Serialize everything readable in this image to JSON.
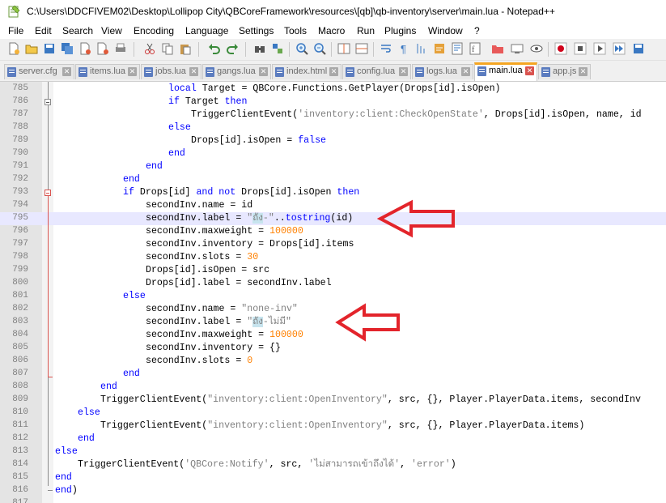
{
  "window": {
    "title": "C:\\Users\\DDCFIVEM02\\Desktop\\Lollipop City\\QBCoreFramework\\resources\\[qb]\\qb-inventory\\server\\main.lua - Notepad++",
    "app_icon": "notepad-plus-plus-icon"
  },
  "menu": [
    "File",
    "Edit",
    "Search",
    "View",
    "Encoding",
    "Language",
    "Settings",
    "Tools",
    "Macro",
    "Run",
    "Plugins",
    "Window",
    "?"
  ],
  "toolbar": [
    "new-file-icon",
    "open-file-icon",
    "save-icon",
    "save-all-icon",
    "close-icon",
    "close-all-icon",
    "print-icon",
    "cut-icon",
    "copy-icon",
    "paste-icon",
    "undo-icon",
    "redo-icon",
    "find-icon",
    "replace-icon",
    "zoom-in-icon",
    "zoom-out-icon",
    "sync-vertical-icon",
    "sync-horizontal-icon",
    "word-wrap-icon",
    "show-all-chars-icon",
    "indent-guide-icon",
    "udl-icon",
    "doc-map-icon",
    "function-list-icon",
    "folder-workspace-icon",
    "monitor-icon",
    "record-macro-icon",
    "stop-macro-icon",
    "play-macro-icon",
    "run-macro-multiple-icon",
    "save-macro-icon"
  ],
  "tabs": [
    {
      "label": "server.cfg",
      "active": false
    },
    {
      "label": "items.lua",
      "active": false
    },
    {
      "label": "jobs.lua",
      "active": false
    },
    {
      "label": "gangs.lua",
      "active": false
    },
    {
      "label": "index.html",
      "active": false
    },
    {
      "label": "config.lua",
      "active": false
    },
    {
      "label": "logs.lua",
      "active": false
    },
    {
      "label": "main.lua",
      "active": true
    },
    {
      "label": "app.js",
      "active": false
    }
  ],
  "colors": {
    "keyword": "#0000ff",
    "string": "#808080",
    "number": "#ff8000",
    "current_line": "#e8e8ff",
    "fold_marker": "#d9534f",
    "annotation_arrow": "#e3242b",
    "active_tab_accent": "#f5a623"
  },
  "editor": {
    "current_line": "795",
    "lines": [
      {
        "n": "785",
        "indent": 20,
        "tokens": [
          [
            "t",
            "local"
          ],
          [
            "p",
            " Target = QBCore.Functions.GetPlayer(Drops[id].isOpen)"
          ]
        ]
      },
      {
        "n": "786",
        "indent": 20,
        "tokens": [
          [
            "k",
            "if"
          ],
          [
            "p",
            " Target "
          ],
          [
            "k",
            "then"
          ]
        ]
      },
      {
        "n": "787",
        "indent": 24,
        "tokens": [
          [
            "p",
            "TriggerClientEvent("
          ],
          [
            "s",
            "'inventory:client:CheckOpenState'"
          ],
          [
            "p",
            ", Drops[id].isOpen, name, id"
          ]
        ]
      },
      {
        "n": "788",
        "indent": 20,
        "tokens": [
          [
            "k",
            "else"
          ]
        ]
      },
      {
        "n": "789",
        "indent": 24,
        "tokens": [
          [
            "p",
            "Drops[id].isOpen = "
          ],
          [
            "k",
            "false"
          ]
        ]
      },
      {
        "n": "790",
        "indent": 20,
        "tokens": [
          [
            "k",
            "end"
          ]
        ]
      },
      {
        "n": "791",
        "indent": 16,
        "tokens": [
          [
            "k",
            "end"
          ]
        ]
      },
      {
        "n": "792",
        "indent": 12,
        "tokens": [
          [
            "k",
            "end"
          ]
        ]
      },
      {
        "n": "793",
        "indent": 12,
        "tokens": [
          [
            "k",
            "if"
          ],
          [
            "p",
            " Drops[id] "
          ],
          [
            "k",
            "and"
          ],
          [
            "p",
            " "
          ],
          [
            "k",
            "not"
          ],
          [
            "p",
            " Drops[id].isOpen "
          ],
          [
            "k",
            "then"
          ]
        ]
      },
      {
        "n": "794",
        "indent": 16,
        "tokens": [
          [
            "p",
            "secondInv.name = id"
          ]
        ]
      },
      {
        "n": "795",
        "indent": 16,
        "tokens": [
          [
            "p",
            "secondInv.label = "
          ],
          [
            "s",
            "\""
          ],
          [
            "x",
            "ถัง"
          ],
          [
            "s",
            "-\""
          ],
          [
            "p",
            ".."
          ],
          [
            "k",
            "tostring"
          ],
          [
            "p",
            "(id)"
          ]
        ]
      },
      {
        "n": "796",
        "indent": 16,
        "tokens": [
          [
            "p",
            "secondInv.maxweight = "
          ],
          [
            "n",
            "100000"
          ]
        ]
      },
      {
        "n": "797",
        "indent": 16,
        "tokens": [
          [
            "p",
            "secondInv.inventory = Drops[id].items"
          ]
        ]
      },
      {
        "n": "798",
        "indent": 16,
        "tokens": [
          [
            "p",
            "secondInv.slots = "
          ],
          [
            "n",
            "30"
          ]
        ]
      },
      {
        "n": "799",
        "indent": 16,
        "tokens": [
          [
            "p",
            "Drops[id].isOpen = src"
          ]
        ]
      },
      {
        "n": "800",
        "indent": 16,
        "tokens": [
          [
            "p",
            "Drops[id].label = secondInv.label"
          ]
        ]
      },
      {
        "n": "801",
        "indent": 12,
        "tokens": [
          [
            "k",
            "else"
          ]
        ]
      },
      {
        "n": "802",
        "indent": 16,
        "tokens": [
          [
            "p",
            "secondInv.name = "
          ],
          [
            "s",
            "\"none-inv\""
          ]
        ]
      },
      {
        "n": "803",
        "indent": 16,
        "tokens": [
          [
            "p",
            "secondInv.label = "
          ],
          [
            "s",
            "\""
          ],
          [
            "x",
            "ถัง"
          ],
          [
            "s",
            "-ไม่มี\""
          ]
        ]
      },
      {
        "n": "804",
        "indent": 16,
        "tokens": [
          [
            "p",
            "secondInv.maxweight = "
          ],
          [
            "n",
            "100000"
          ]
        ]
      },
      {
        "n": "805",
        "indent": 16,
        "tokens": [
          [
            "p",
            "secondInv.inventory = {}"
          ]
        ]
      },
      {
        "n": "806",
        "indent": 16,
        "tokens": [
          [
            "p",
            "secondInv.slots = "
          ],
          [
            "n",
            "0"
          ]
        ]
      },
      {
        "n": "807",
        "indent": 12,
        "tokens": [
          [
            "k",
            "end"
          ]
        ]
      },
      {
        "n": "808",
        "indent": 8,
        "tokens": [
          [
            "k",
            "end"
          ]
        ]
      },
      {
        "n": "809",
        "indent": 8,
        "tokens": [
          [
            "p",
            "TriggerClientEvent("
          ],
          [
            "s",
            "\"inventory:client:OpenInventory\""
          ],
          [
            "p",
            ", src, {}, Player.PlayerData.items, secondInv"
          ]
        ]
      },
      {
        "n": "810",
        "indent": 4,
        "tokens": [
          [
            "k",
            "else"
          ]
        ]
      },
      {
        "n": "811",
        "indent": 8,
        "tokens": [
          [
            "p",
            "TriggerClientEvent("
          ],
          [
            "s",
            "\"inventory:client:OpenInventory\""
          ],
          [
            "p",
            ", src, {}, Player.PlayerData.items)"
          ]
        ]
      },
      {
        "n": "812",
        "indent": 4,
        "tokens": [
          [
            "k",
            "end"
          ]
        ]
      },
      {
        "n": "813",
        "indent": 0,
        "tokens": [
          [
            "k",
            "else"
          ]
        ]
      },
      {
        "n": "814",
        "indent": 4,
        "tokens": [
          [
            "p",
            "TriggerClientEvent("
          ],
          [
            "s",
            "'QBCore:Notify'"
          ],
          [
            "p",
            ", src, "
          ],
          [
            "s",
            "'ไม่สามารถเข้าถึงได้'"
          ],
          [
            "p",
            ", "
          ],
          [
            "s",
            "'error'"
          ],
          [
            "p",
            ")"
          ]
        ]
      },
      {
        "n": "815",
        "indent": 0,
        "tokens": [
          [
            "k",
            "end"
          ]
        ]
      },
      {
        "n": "816",
        "indent": 0,
        "tokens": [
          [
            "k",
            "end"
          ],
          [
            "p",
            ")"
          ]
        ]
      },
      {
        "n": "817",
        "indent": 0,
        "tokens": []
      }
    ]
  },
  "annotations": [
    {
      "name": "annotation-arrow-line-795",
      "points_to": "795"
    },
    {
      "name": "annotation-arrow-line-803",
      "points_to": "803"
    }
  ]
}
